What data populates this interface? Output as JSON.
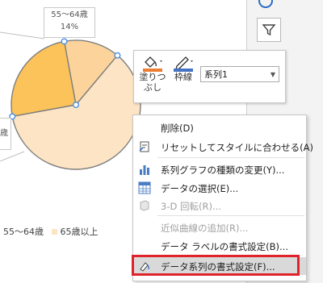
{
  "chart": {
    "type": "pie",
    "slice_label_name": "55～64歳",
    "slice_label_value": "14%",
    "left_label_partial": "歳",
    "legend": [
      {
        "label": "55～64歳",
        "color": "#fcd49b"
      },
      {
        "label": "65歳以上",
        "color": "#fde4c4"
      }
    ],
    "colors": {
      "light": "#fde4c4",
      "medium": "#fcd49b",
      "dark": "#fcc35a",
      "handle": "#4a90e2"
    }
  },
  "chart_data": {
    "type": "pie",
    "categories": [
      "55～64歳",
      "",
      "65歳以上"
    ],
    "values": [
      14,
      25,
      61
    ]
  },
  "toolbar": {
    "fill_label_1": "塗りつ",
    "fill_label_2": "ぶし",
    "border_label": "枠線",
    "series_value": "系列1"
  },
  "menu": {
    "items": [
      {
        "label": "削除(D)",
        "icon": "none",
        "disabled": false
      },
      {
        "label": "リセットしてスタイルに合わせる(A)",
        "icon": "reset-style-icon",
        "disabled": false
      },
      {
        "label": "系列グラフの種類の変更(Y)...",
        "icon": "bar-chart-icon",
        "disabled": false
      },
      {
        "label": "データの選択(E)...",
        "icon": "data-table-icon",
        "disabled": false
      },
      {
        "label": "3-D 回転(R)...",
        "icon": "3d-rotate-icon",
        "disabled": true
      },
      {
        "label": "近似曲線の追加(R)...",
        "icon": "none",
        "disabled": true
      },
      {
        "label": "データ ラベルの書式設定(B)...",
        "icon": "none",
        "disabled": false
      },
      {
        "label": "データ系列の書式設定(F)...",
        "icon": "format-series-icon",
        "disabled": false
      }
    ]
  }
}
